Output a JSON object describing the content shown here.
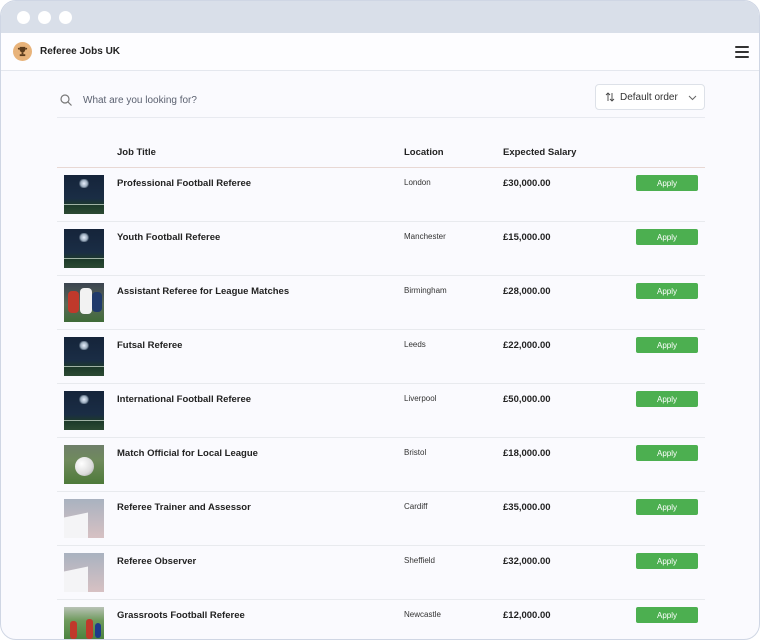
{
  "app": {
    "title": "Referee Jobs UK"
  },
  "search": {
    "placeholder": "What are you looking for?"
  },
  "sort": {
    "selected": "Default order"
  },
  "table": {
    "headers": {
      "title": "Job Title",
      "location": "Location",
      "salary": "Expected Salary"
    },
    "apply_label": "Apply",
    "rows": [
      {
        "title": "Professional Football Referee",
        "location": "London",
        "salary": "£30,000.00",
        "thumb": "night-pitch"
      },
      {
        "title": "Youth Football Referee",
        "location": "Manchester",
        "salary": "£15,000.00",
        "thumb": "night-pitch"
      },
      {
        "title": "Assistant Referee for League Matches",
        "location": "Birmingham",
        "salary": "£28,000.00",
        "thumb": "players"
      },
      {
        "title": "Futsal Referee",
        "location": "Leeds",
        "salary": "£22,000.00",
        "thumb": "night-pitch"
      },
      {
        "title": "International Football Referee",
        "location": "Liverpool",
        "salary": "£50,000.00",
        "thumb": "night-pitch"
      },
      {
        "title": "Match Official for Local League",
        "location": "Bristol",
        "salary": "£18,000.00",
        "thumb": "ball"
      },
      {
        "title": "Referee Trainer and Assessor",
        "location": "Cardiff",
        "salary": "£35,000.00",
        "thumb": "wall"
      },
      {
        "title": "Referee Observer",
        "location": "Sheffield",
        "salary": "£32,000.00",
        "thumb": "wall"
      },
      {
        "title": "Grassroots Football Referee",
        "location": "Newcastle",
        "salary": "£12,000.00",
        "thumb": "grass-players"
      }
    ]
  },
  "colors": {
    "accent": "#4caf50",
    "chrome": "#d9dfe9"
  }
}
